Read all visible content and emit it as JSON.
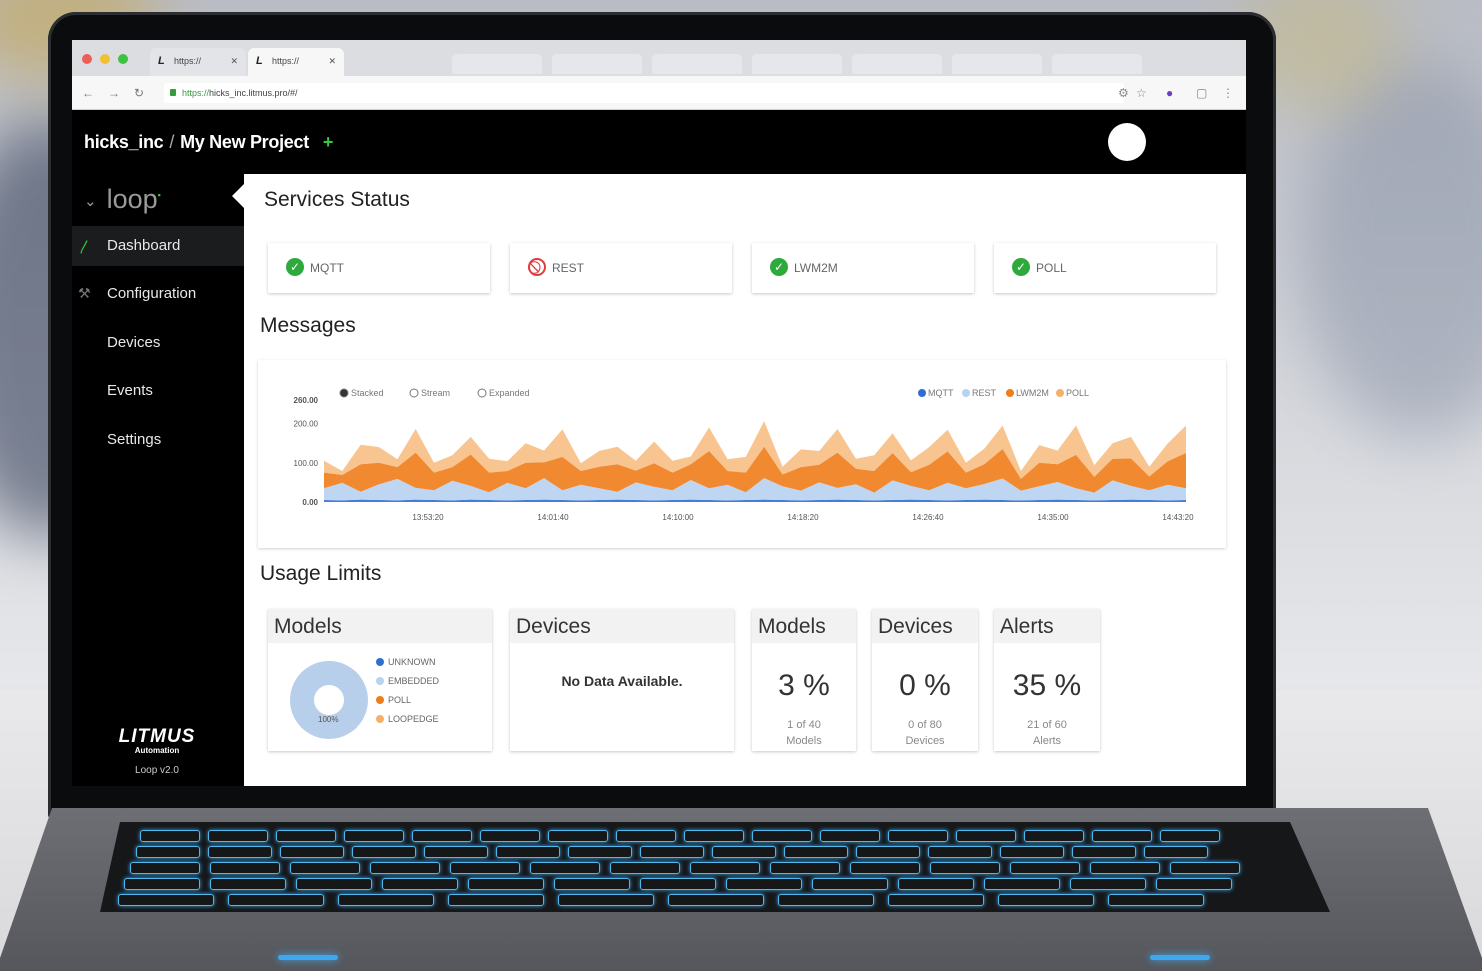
{
  "browser": {
    "tabs": [
      {
        "label": "https://",
        "favicon": "litmus-logo-icon"
      },
      {
        "label": "https://",
        "favicon": "litmus-logo-icon"
      }
    ],
    "url_protocol": "https://",
    "url_host": "hicks_inc.litmus.pro/#/"
  },
  "header": {
    "org": "hicks_inc",
    "separator": "/",
    "project": "My New Project",
    "add": "+"
  },
  "sidebar": {
    "app_name": "loop",
    "items": [
      {
        "label": "Dashboard",
        "active": true,
        "icon": "pulse-icon"
      },
      {
        "label": "Configuration",
        "active": false,
        "icon": "wrench-icon"
      },
      {
        "label": "Devices",
        "active": false
      },
      {
        "label": "Events",
        "active": false
      },
      {
        "label": "Settings",
        "active": false
      }
    ],
    "brand_logo": "LITMUS",
    "brand_sub": "Automation",
    "version": "Loop v2.0"
  },
  "services": {
    "title": "Services Status",
    "items": [
      {
        "name": "MQTT",
        "status": "ok"
      },
      {
        "name": "REST",
        "status": "blocked"
      },
      {
        "name": "LWM2M",
        "status": "ok"
      },
      {
        "name": "POLL",
        "status": "ok"
      }
    ]
  },
  "messages": {
    "title": "Messages",
    "modes": [
      {
        "label": "Stacked",
        "selected": true
      },
      {
        "label": "Stream",
        "selected": false
      },
      {
        "label": "Expanded",
        "selected": false
      }
    ],
    "legend": [
      {
        "label": "MQTT",
        "color": "#2f6fd1"
      },
      {
        "label": "REST",
        "color": "#b8d2f2"
      },
      {
        "label": "LWM2M",
        "color": "#f07c1a"
      },
      {
        "label": "POLL",
        "color": "#f6b06a"
      }
    ]
  },
  "chart_data": {
    "type": "area",
    "stacked": true,
    "ylim": [
      0,
      260
    ],
    "yticks": [
      "260.00",
      "200.00",
      "100.00",
      "0.00"
    ],
    "xticks": [
      "13:53:20",
      "14:01:40",
      "14:10:00",
      "14:18:20",
      "14:26:40",
      "14:35:00",
      "14:43:20"
    ],
    "series": [
      {
        "name": "MQTT",
        "values": [
          5,
          4,
          6,
          5,
          4,
          6,
          5,
          4,
          6,
          5,
          4,
          5,
          6,
          5,
          4,
          5,
          6,
          5,
          4,
          5,
          6,
          5,
          4,
          5,
          6,
          5,
          4,
          5,
          6,
          5,
          4,
          5,
          6,
          5,
          4,
          5,
          6,
          5,
          4,
          5,
          6,
          5,
          4,
          5,
          6,
          5,
          4,
          5
        ]
      },
      {
        "name": "REST",
        "values": [
          30,
          45,
          20,
          40,
          55,
          30,
          25,
          50,
          35,
          20,
          45,
          30,
          55,
          25,
          40,
          30,
          20,
          45,
          35,
          25,
          50,
          30,
          40,
          20,
          55,
          35,
          25,
          45,
          30,
          40,
          20,
          50,
          35,
          25,
          45,
          30,
          40,
          55,
          25,
          35,
          45,
          30,
          20,
          50,
          35,
          25,
          40,
          30
        ]
      },
      {
        "name": "LWM2M",
        "values": [
          40,
          20,
          70,
          55,
          30,
          90,
          45,
          35,
          80,
          50,
          30,
          65,
          40,
          85,
          35,
          55,
          70,
          30,
          60,
          45,
          40,
          95,
          35,
          50,
          80,
          30,
          60,
          45,
          90,
          40,
          55,
          70,
          35,
          65,
          80,
          40,
          50,
          75,
          30,
          60,
          45,
          85,
          40,
          55,
          70,
          35,
          60,
          90
        ]
      },
      {
        "name": "POLL",
        "values": [
          30,
          10,
          50,
          40,
          20,
          60,
          25,
          30,
          45,
          35,
          25,
          50,
          30,
          70,
          20,
          40,
          45,
          25,
          55,
          30,
          20,
          60,
          30,
          40,
          65,
          20,
          45,
          35,
          60,
          25,
          40,
          50,
          30,
          45,
          55,
          25,
          40,
          60,
          20,
          45,
          35,
          75,
          30,
          40,
          55,
          25,
          45,
          70
        ]
      }
    ]
  },
  "usage": {
    "title": "Usage Limits",
    "models_chart": {
      "title": "Models",
      "center_label": "100%",
      "legend": [
        {
          "label": "UNKNOWN",
          "color": "#2f6fd1"
        },
        {
          "label": "EMBEDDED",
          "color": "#b8d2f2"
        },
        {
          "label": "POLL",
          "color": "#f07c1a"
        },
        {
          "label": "LOOPEDGE",
          "color": "#f6b06a"
        }
      ]
    },
    "devices_chart": {
      "title": "Devices",
      "empty_text": "No Data Available."
    },
    "limits": [
      {
        "title": "Models",
        "percent": "3 %",
        "line1": "1 of 40",
        "line2": "Models"
      },
      {
        "title": "Devices",
        "percent": "0 %",
        "line1": "0 of 80",
        "line2": "Devices"
      },
      {
        "title": "Alerts",
        "percent": "35 %",
        "line1": "21 of 60",
        "line2": "Alerts"
      }
    ]
  }
}
